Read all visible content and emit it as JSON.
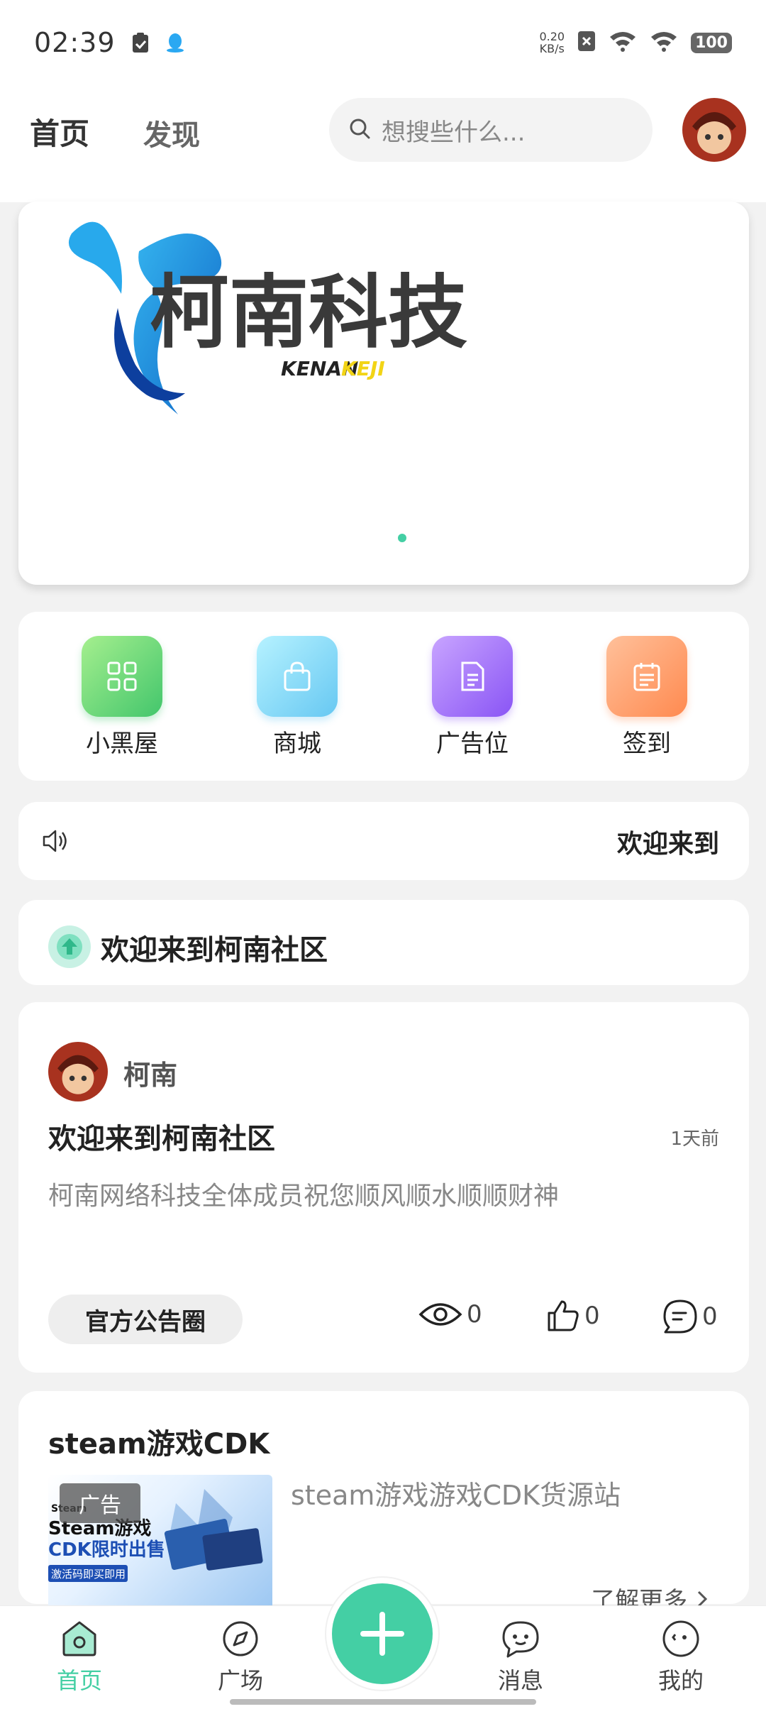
{
  "status_bar": {
    "time": "02:39",
    "net_speed_value": "0.20",
    "net_speed_unit": "KB/s",
    "battery": "100"
  },
  "header": {
    "tabs": [
      {
        "label": "首页",
        "active": true
      },
      {
        "label": "发现",
        "active": false
      }
    ],
    "search_placeholder": "想搜些什么..."
  },
  "banner": {
    "logo_text": "柯南科技",
    "logo_sub_1": "KENAN",
    "logo_sub_2": "KEJI"
  },
  "quick_actions": [
    {
      "label": "小黑屋",
      "icon": "grid-icon"
    },
    {
      "label": "商城",
      "icon": "shopping-bag-icon"
    },
    {
      "label": "广告位",
      "icon": "document-icon"
    },
    {
      "label": "签到",
      "icon": "calendar-icon"
    }
  ],
  "notice": {
    "text": "欢迎来到"
  },
  "section": {
    "title": "欢迎来到柯南社区"
  },
  "post": {
    "author": "柯南",
    "title": "欢迎来到柯南社区",
    "time": "1天前",
    "body": "柯南网络科技全体成员祝您顺风顺水顺顺财神",
    "tag": "官方公告圈",
    "views": "0",
    "likes": "0",
    "comments": "0"
  },
  "ad": {
    "title": "steam游戏CDK",
    "badge": "广告",
    "image_line1": "Steam游戏",
    "image_line2": "CDK限时出售",
    "image_line3": "激活码即买即用",
    "image_brand": "Steam",
    "description": "steam游戏游戏CDK货源站",
    "more": "了解更多"
  },
  "bottom_nav": [
    {
      "label": "首页",
      "active": true
    },
    {
      "label": "广场",
      "active": false
    },
    {
      "label": "消息",
      "active": false
    },
    {
      "label": "我的",
      "active": false
    }
  ],
  "colors": {
    "accent": "#44cfa4"
  }
}
